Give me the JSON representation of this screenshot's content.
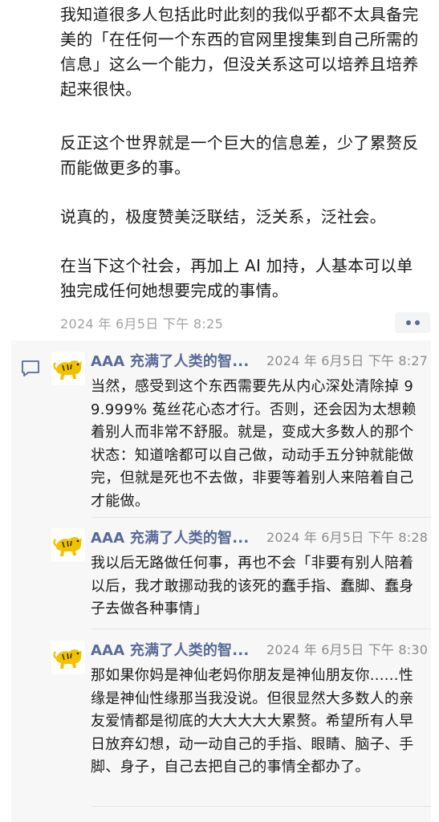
{
  "post": {
    "paragraphs": [
      "我知道很多人包括此时此刻的我似乎都不太具备完美的「在任何一个东西的官网里搜集到自己所需的信息」这么一个能力，但没关系这可以培养且培养起来很快。",
      "反正这个世界就是一个巨大的信息差，少了累赘反而能做更多的事。",
      "说真的，极度赞美泛联结，泛关系，泛社会。",
      "在当下这个社会，再加上 AI 加持，人基本可以单独完成任何她想要完成的事情。"
    ],
    "timestamp": "2024 年 6月5日 下午 8:25"
  },
  "comments_icon": "comment-bubble-icon",
  "comments": [
    {
      "name": "AAA 充满了人类的智...",
      "time": "2024 年 6月5日 下午 8:27",
      "text": "当然，感受到这个东西需要先从内心深处清除掉 99.999% 菟丝花心态才行。否则，还会因为太想赖着别人而非常不舒服。就是，变成大多数人的那个状态：知道啥都可以自己做，动动手五分钟就能做完，但就是死也不去做，非要等着别人来陪着自己才能做。"
    },
    {
      "name": "AAA 充满了人类的智...",
      "time": "2024 年 6月5日 下午 8:28",
      "text": "我以后无路做任何事，再也不会「非要有别人陪着以后，我才敢挪动我的该死的蠢手指、蠢脚、蠢身子去做各种事情」"
    },
    {
      "name": "AAA 充满了人类的智...",
      "time": "2024 年 6月5日 下午 8:30",
      "text": "那如果你妈是神仙老妈你朋友是神仙朋友你......性缘是神仙性缘那当我没说。但很显然大多数人的亲友爱情都是彻底的大大大大大累赘。希望所有人早日放弃幻想，动一动自己的手指、眼睛、脑子、手脚、身子，自己去把自己的事情全都办了。"
    }
  ],
  "colors": {
    "name": "#576b95",
    "timestamp": "#a3a3a3",
    "comment_bg": "#f7f7f7",
    "avatar_yellow": "#f2c200"
  }
}
